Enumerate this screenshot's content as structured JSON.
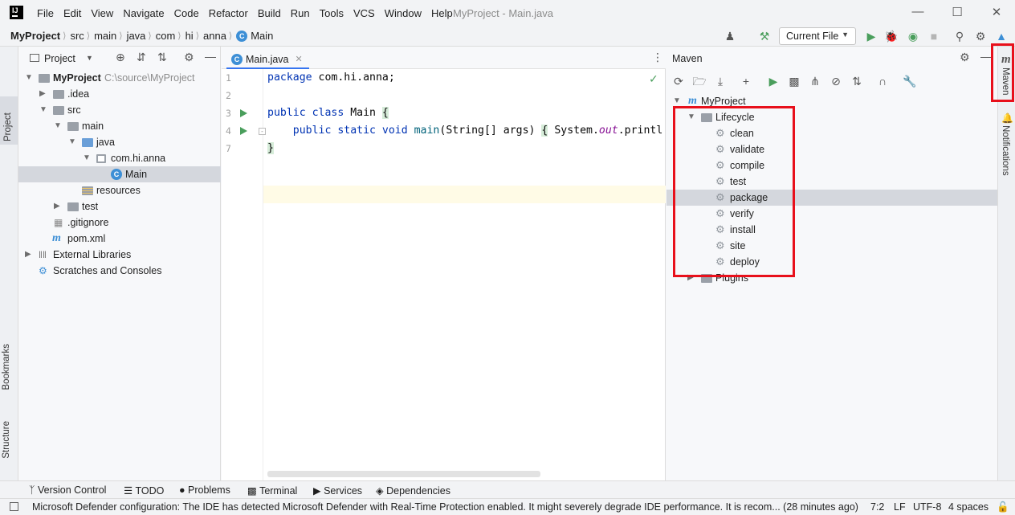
{
  "menu": {
    "items": [
      "File",
      "Edit",
      "View",
      "Navigate",
      "Code",
      "Refactor",
      "Build",
      "Run",
      "Tools",
      "VCS",
      "Window",
      "Help"
    ],
    "window_title": "MyProject - Main.java"
  },
  "navbar": {
    "crumbs": [
      "MyProject",
      "src",
      "main",
      "java",
      "com",
      "hi",
      "anna",
      "Main"
    ],
    "run_config": "Current File"
  },
  "left_strip": {
    "project": "Project",
    "bookmarks": "Bookmarks",
    "structure": "Structure"
  },
  "project_panel": {
    "title": "Project",
    "tree": [
      {
        "label": "MyProject",
        "note": "C:\\source\\MyProject"
      },
      {
        "label": ".idea"
      },
      {
        "label": "src"
      },
      {
        "label": "main"
      },
      {
        "label": "java"
      },
      {
        "label": "com.hi.anna"
      },
      {
        "label": "Main"
      },
      {
        "label": "resources"
      },
      {
        "label": "test"
      },
      {
        "label": ".gitignore"
      },
      {
        "label": "pom.xml"
      },
      {
        "label": "External Libraries"
      },
      {
        "label": "Scratches and Consoles"
      }
    ]
  },
  "editor": {
    "tab": "Main.java",
    "line_numbers": [
      "1",
      "2",
      "3",
      "4",
      "7"
    ],
    "code": {
      "l1_kw": "package",
      "l1_rest": " com.hi.anna;",
      "l3_kw": "public class",
      "l3_name": " Main ",
      "l3_brace": "{",
      "l4_kw": "    public static void",
      "l4_fn": " main",
      "l4_args": "(String[] args) ",
      "l4_brace": "{",
      "l4_body1": " System.",
      "l4_out": "out",
      "l4_body2": ".printl",
      "l7_brace": "}"
    }
  },
  "maven": {
    "title": "Maven",
    "project": "MyProject",
    "lifecycle": "Lifecycle",
    "phases": [
      "clean",
      "validate",
      "compile",
      "test",
      "package",
      "verify",
      "install",
      "site",
      "deploy"
    ],
    "plugins": "Plugins"
  },
  "right_strip": {
    "maven": "Maven",
    "notifications": "Notifications"
  },
  "bottom_tabs": [
    "Version Control",
    "TODO",
    "Problems",
    "Terminal",
    "Services",
    "Dependencies"
  ],
  "status": {
    "message": "Microsoft Defender configuration: The IDE has detected Microsoft Defender with Real-Time Protection enabled. It might severely degrade IDE performance. It is recom... (28 minutes ago)",
    "position": "7:2",
    "line_sep": "LF",
    "encoding": "UTF-8",
    "indent": "4 spaces"
  },
  "colors": {
    "highlight": "#e8101b",
    "accent": "#3574f0",
    "run_green": "#4a9e5c"
  },
  "icons": [
    "intellij-logo-icon",
    "class-icon",
    "hammer-icon",
    "run-icon",
    "debug-icon",
    "search-icon",
    "gear-icon",
    "maven-icon",
    "bell-icon"
  ]
}
